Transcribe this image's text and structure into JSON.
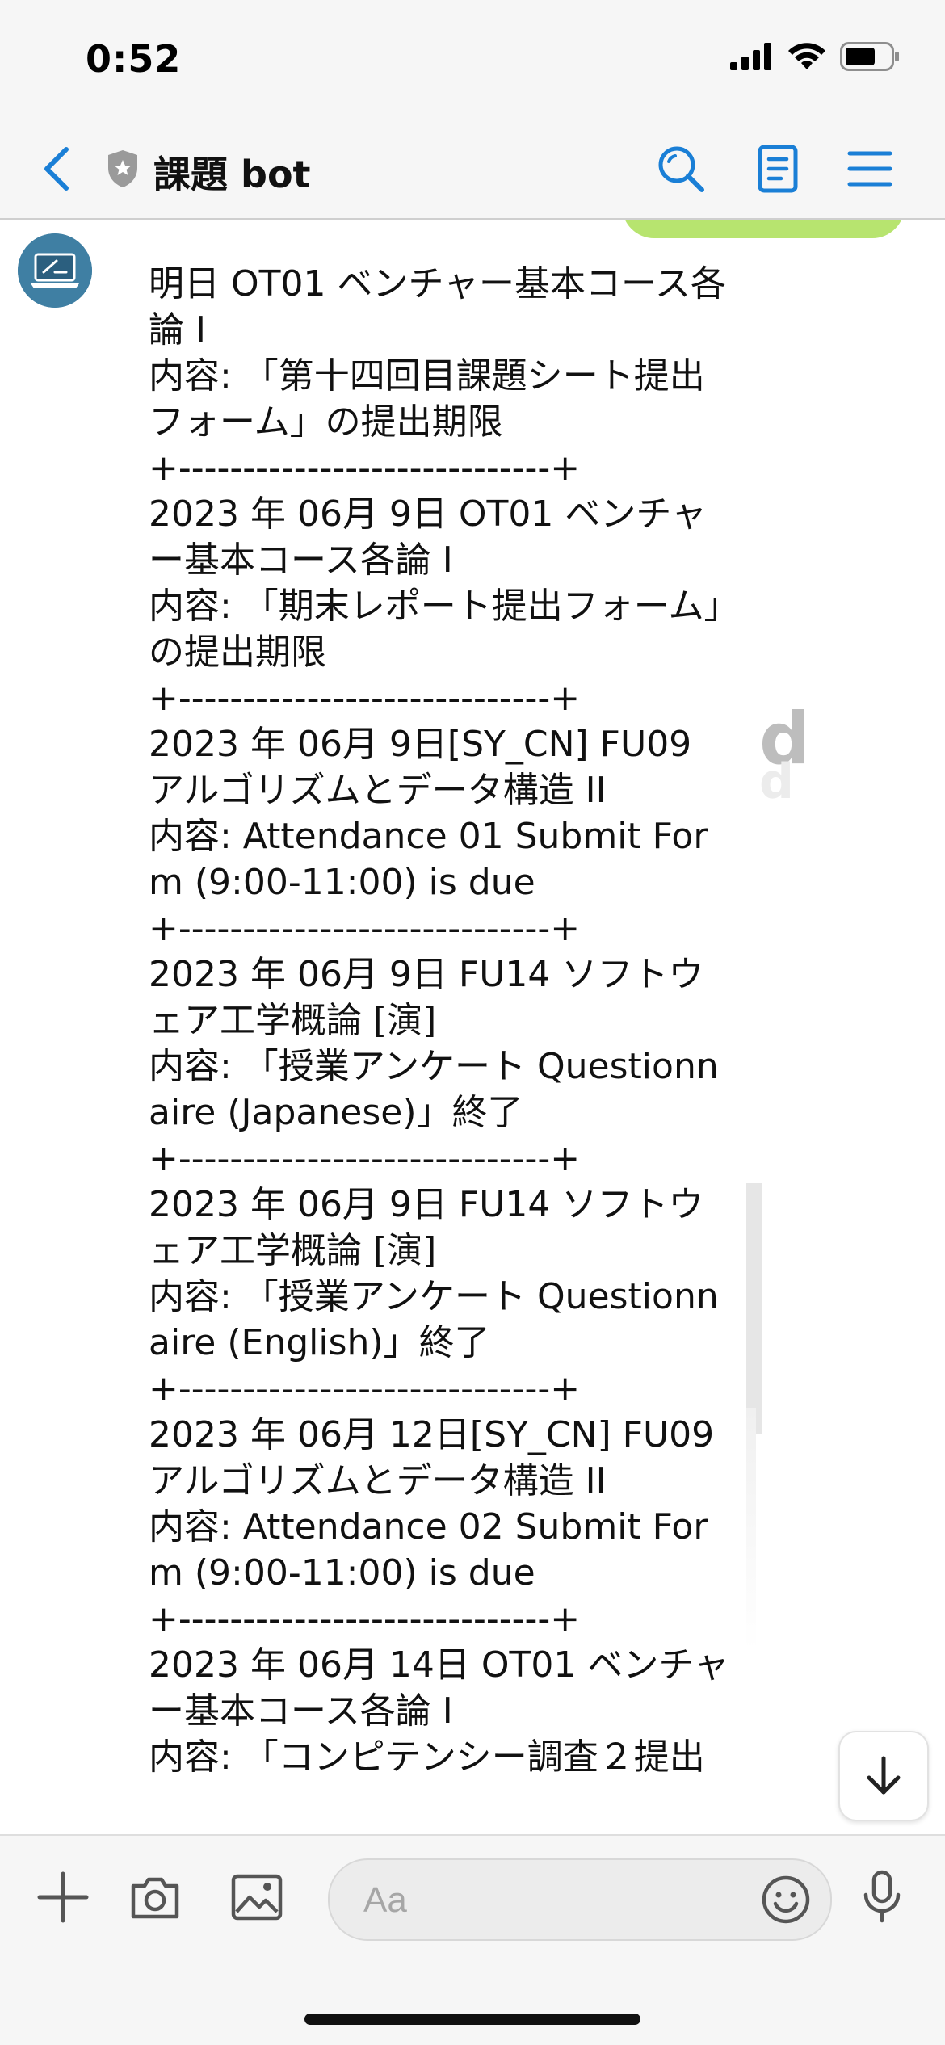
{
  "status_bar": {
    "time": "0:52"
  },
  "header": {
    "title": "課題 bot"
  },
  "message": {
    "text": "明日 OT01 ベンチャー基本コース各論 I\n内容: 「第十四回目課題シート提出フォーム」の提出期限\n+-----------------------------+\n2023 年 06月 9日 OT01 ベンチャー基本コース各論 I\n内容: 「期末レポート提出フォーム」の提出期限\n+-----------------------------+\n2023 年 06月 9日[SY_CN] FU09 アルゴリズムとデータ構造 II\n内容: Attendance 01 Submit Form (9:00-11:00) is due\n+-----------------------------+\n2023 年 06月 9日 FU14 ソフトウェア工学概論 [演]\n内容: 「授業アンケート Questionnaire (Japanese)」終了\n+-----------------------------+\n2023 年 06月 9日 FU14 ソフトウェア工学概論 [演]\n内容: 「授業アンケート Questionnaire (English)」終了\n+-----------------------------+\n2023 年 06月 12日[SY_CN] FU09 アルゴリズムとデータ構造 II\n内容: Attendance 02 Submit Form (9:00-11:00) is due\n+-----------------------------+\n2023 年 06月 14日 OT01 ベンチャー基本コース各論 I\n内容: 「コンピテンシー調査２提出"
  },
  "background_glyph": "d",
  "input_bar": {
    "placeholder": "Aa"
  },
  "colors": {
    "accent": "#1a7fd6",
    "header_bg": "#f6f6f6",
    "avatar_bg": "#3f7fa3",
    "bubble_peek": "#b7e46f"
  },
  "icons": {
    "back": "chevron-left-icon",
    "verified": "shield-icon",
    "search": "search-icon",
    "notes": "document-icon",
    "menu": "hamburger-icon",
    "plus": "plus-icon",
    "camera": "camera-icon",
    "image": "image-icon",
    "emoji": "smile-icon",
    "mic": "microphone-icon",
    "scroll": "arrow-down-icon"
  }
}
